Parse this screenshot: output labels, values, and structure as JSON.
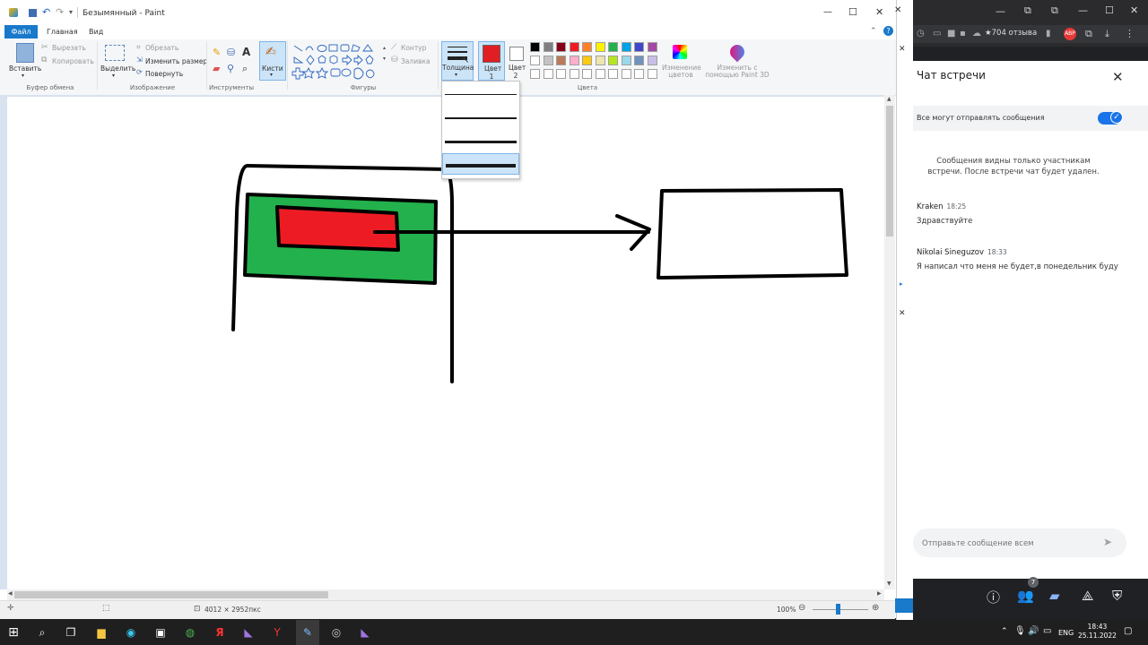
{
  "paint": {
    "title": "Безымянный - Paint",
    "menu": {
      "file": "Файл",
      "home": "Главная",
      "view": "Вид"
    },
    "clipboard": {
      "paste": "Вставить",
      "cut": "Вырезать",
      "copy": "Копировать",
      "group": "Буфер обмена"
    },
    "image": {
      "select": "Выделить",
      "crop": "Обрезать",
      "resize": "Изменить размер",
      "rotate": "Повернуть",
      "group": "Изображение"
    },
    "tools": {
      "group": "Инструменты"
    },
    "brushes": {
      "label": "Кисти"
    },
    "shapes": {
      "outline": "Контур",
      "fill": "Заливка",
      "group": "Фигуры"
    },
    "thickness": {
      "label": "Толщина"
    },
    "color1": {
      "label": "Цвет 1",
      "value": "#e01e23"
    },
    "color2": {
      "label": "Цвет 2",
      "value": "#ffffff"
    },
    "colors_group": "Цвета",
    "edit_colors": "Изменение цветов",
    "paint3d": "Изменить с помощью Paint 3D",
    "palette_row1": [
      "#000000",
      "#7f7f7f",
      "#880015",
      "#ed1c24",
      "#ff7f27",
      "#fff200",
      "#22b14c",
      "#00a2e8",
      "#3f48cc",
      "#a349a4"
    ],
    "palette_row2": [
      "#ffffff",
      "#c3c3c3",
      "#b97a57",
      "#ffaec9",
      "#ffc90e",
      "#efe4b0",
      "#b5e61d",
      "#99d9ea",
      "#7092be",
      "#c8bfe7"
    ],
    "status": {
      "size": "4012 × 2952пкс",
      "zoom": "100%"
    }
  },
  "chat": {
    "title": "Чат встречи",
    "toggle_label": "Все могут отправлять сообщения",
    "note": "Сообщения видны только участникам встречи. После встречи чат будет удален.",
    "messages": [
      {
        "author": "Kraken",
        "time": "18:25",
        "text": "Здравствуйте"
      },
      {
        "author": "Nikolai Sineguzov",
        "time": "18:33",
        "text": "Я написал что меня не будет,в понедельник буду"
      }
    ],
    "input_placeholder": "Отправьте сообщение всем",
    "participants_count": "7"
  },
  "browser": {
    "reviews": "704 отзыва",
    "ext_abp": "ABP"
  },
  "taskbar": {
    "lang": "ENG",
    "time": "18:43",
    "date": "25.11.2022"
  }
}
